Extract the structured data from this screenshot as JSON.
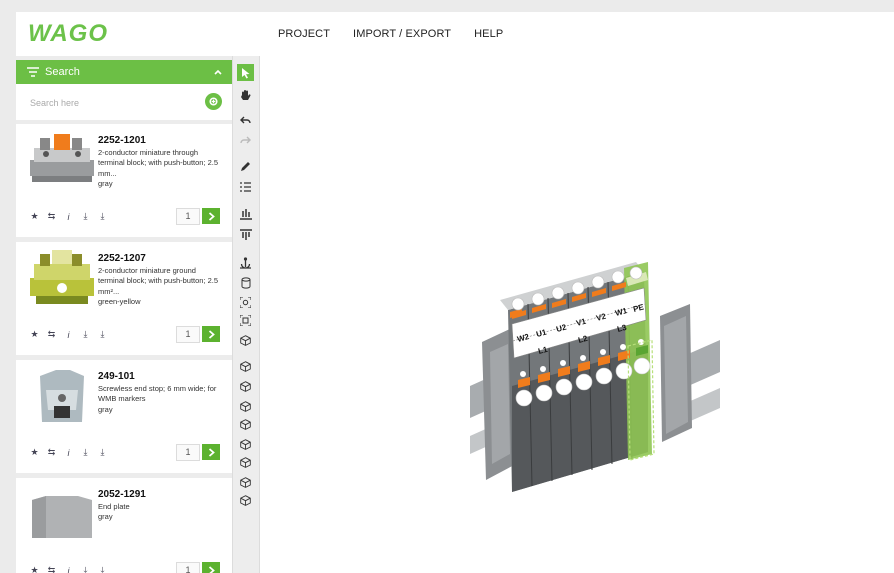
{
  "app": {
    "logo_text": "WAGO",
    "brand_color": "#6cc24a",
    "menu": [
      "PROJECT",
      "IMPORT / EXPORT",
      "HELP"
    ]
  },
  "search": {
    "header_label": "Search",
    "placeholder": "Search here"
  },
  "products": [
    {
      "part_number": "2252-1201",
      "description": "2-conductor miniature through terminal block; with push-button; 2.5 mm...",
      "color": "gray",
      "qty": "1"
    },
    {
      "part_number": "2252-1207",
      "description": "2-conductor miniature ground terminal block; with push-button; 2.5 mm²...",
      "color": "green-yellow",
      "qty": "1"
    },
    {
      "part_number": "249-101",
      "description": "Screwless end stop; 6 mm wide; for WMB markers",
      "color": "gray",
      "qty": "1"
    },
    {
      "part_number": "2052-1291",
      "description": "End plate",
      "color": "gray",
      "qty": "1"
    }
  ],
  "card_actions": [
    "star-icon",
    "repeat-icon",
    "info-icon",
    "download-icon",
    "download-icon"
  ],
  "toolbar_icons": [
    "pointer-icon",
    "hand-icon",
    "undo-icon",
    "redo-icon",
    "pen-icon",
    "list-icon",
    "align-bottom-icon",
    "align-top-icon",
    "anchor-icon",
    "cylinder-icon",
    "focus-icon",
    "frame-icon",
    "cube-icon",
    "cube-icon",
    "cube-icon",
    "cube-icon",
    "cube-icon",
    "cube-icon",
    "cube-icon",
    "cube-icon",
    "cube-icon",
    "cube-icon"
  ],
  "markers_top": [
    "W2",
    "U1",
    "U2",
    "V1",
    "V2",
    "W1",
    "PE"
  ],
  "markers_bottom": [
    "L1",
    "L2",
    "L3"
  ]
}
